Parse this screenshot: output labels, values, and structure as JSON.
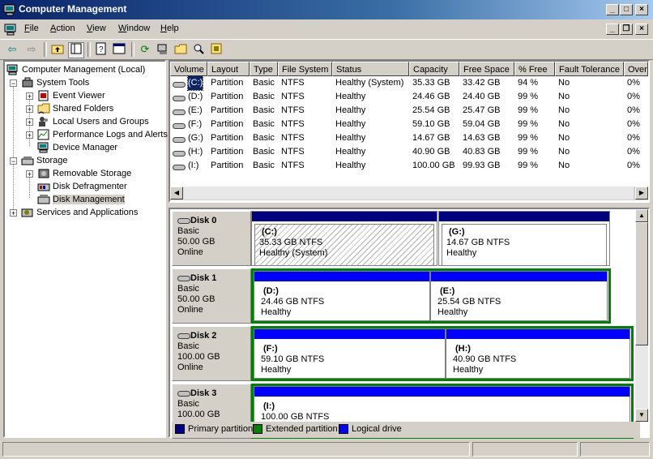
{
  "window": {
    "title": "Computer Management"
  },
  "menu": [
    {
      "label": "File",
      "key": "F"
    },
    {
      "label": "Action",
      "key": "A"
    },
    {
      "label": "View",
      "key": "V"
    },
    {
      "label": "Window",
      "key": "W"
    },
    {
      "label": "Help",
      "key": "H"
    }
  ],
  "tree": {
    "root": "Computer Management (Local)",
    "system_tools": "System Tools",
    "event_viewer": "Event Viewer",
    "shared_folders": "Shared Folders",
    "local_users": "Local Users and Groups",
    "perf_logs": "Performance Logs and Alerts",
    "device_manager": "Device Manager",
    "storage": "Storage",
    "removable_storage": "Removable Storage",
    "disk_defrag": "Disk Defragmenter",
    "disk_management": "Disk Management",
    "services_apps": "Services and Applications"
  },
  "columns": [
    "Volume",
    "Layout",
    "Type",
    "File System",
    "Status",
    "Capacity",
    "Free Space",
    "% Free",
    "Fault Tolerance",
    "Overhead"
  ],
  "volumes": [
    {
      "volume": "(C:)",
      "layout": "Partition",
      "type": "Basic",
      "fs": "NTFS",
      "status": "Healthy (System)",
      "capacity": "35.33 GB",
      "free": "33.42 GB",
      "pct": "94 %",
      "fault": "No",
      "overhead": "0%"
    },
    {
      "volume": "(D:)",
      "layout": "Partition",
      "type": "Basic",
      "fs": "NTFS",
      "status": "Healthy",
      "capacity": "24.46 GB",
      "free": "24.40 GB",
      "pct": "99 %",
      "fault": "No",
      "overhead": "0%"
    },
    {
      "volume": "(E:)",
      "layout": "Partition",
      "type": "Basic",
      "fs": "NTFS",
      "status": "Healthy",
      "capacity": "25.54 GB",
      "free": "25.47 GB",
      "pct": "99 %",
      "fault": "No",
      "overhead": "0%"
    },
    {
      "volume": "(F:)",
      "layout": "Partition",
      "type": "Basic",
      "fs": "NTFS",
      "status": "Healthy",
      "capacity": "59.10 GB",
      "free": "59.04 GB",
      "pct": "99 %",
      "fault": "No",
      "overhead": "0%"
    },
    {
      "volume": "(G:)",
      "layout": "Partition",
      "type": "Basic",
      "fs": "NTFS",
      "status": "Healthy",
      "capacity": "14.67 GB",
      "free": "14.63 GB",
      "pct": "99 %",
      "fault": "No",
      "overhead": "0%"
    },
    {
      "volume": "(H:)",
      "layout": "Partition",
      "type": "Basic",
      "fs": "NTFS",
      "status": "Healthy",
      "capacity": "40.90 GB",
      "free": "40.83 GB",
      "pct": "99 %",
      "fault": "No",
      "overhead": "0%"
    },
    {
      "volume": "(I:)",
      "layout": "Partition",
      "type": "Basic",
      "fs": "NTFS",
      "status": "Healthy",
      "capacity": "100.00 GB",
      "free": "99.93 GB",
      "pct": "99 %",
      "fault": "No",
      "overhead": "0%"
    }
  ],
  "disks": [
    {
      "name": "Disk 0",
      "type": "Basic",
      "size": "50.00 GB",
      "state": "Online",
      "partitions": [
        {
          "letter": "(C:)",
          "size": "35.33 GB NTFS",
          "status": "Healthy (System)"
        },
        {
          "letter": "(G:)",
          "size": "14.67 GB NTFS",
          "status": "Healthy"
        }
      ]
    },
    {
      "name": "Disk 1",
      "type": "Basic",
      "size": "50.00 GB",
      "state": "Online",
      "partitions": [
        {
          "letter": "(D:)",
          "size": "24.46 GB NTFS",
          "status": "Healthy"
        },
        {
          "letter": "(E:)",
          "size": "25.54 GB NTFS",
          "status": "Healthy"
        }
      ]
    },
    {
      "name": "Disk 2",
      "type": "Basic",
      "size": "100.00 GB",
      "state": "Online",
      "partitions": [
        {
          "letter": "(F:)",
          "size": "59.10 GB NTFS",
          "status": "Healthy"
        },
        {
          "letter": "(H:)",
          "size": "40.90 GB NTFS",
          "status": "Healthy"
        }
      ]
    },
    {
      "name": "Disk 3",
      "type": "Basic",
      "size": "100.00 GB",
      "state": "",
      "partitions": [
        {
          "letter": "(I:)",
          "size": "100.00 GB NTFS",
          "status": ""
        }
      ]
    }
  ],
  "legend": {
    "primary": "Primary partition",
    "extended": "Extended partition",
    "logical": "Logical drive"
  },
  "colors": {
    "primary": "#000080",
    "extended": "#008000",
    "logical": "#0000ff",
    "titlebar": "#0a246a"
  }
}
